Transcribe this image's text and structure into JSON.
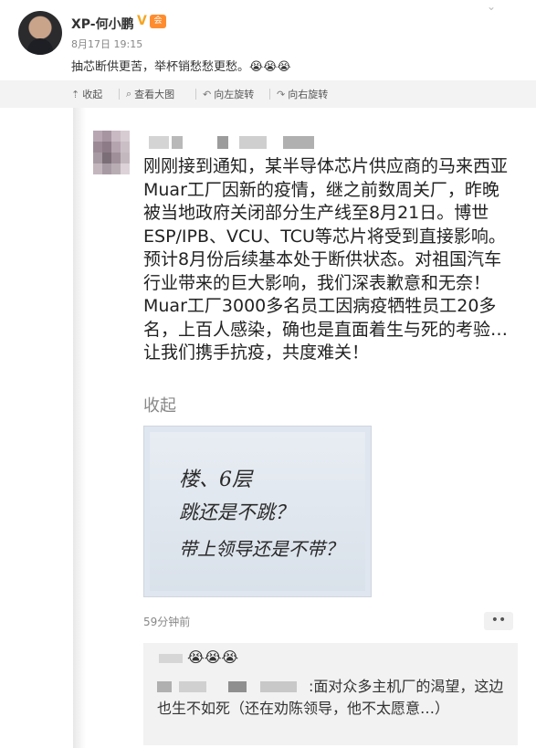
{
  "post": {
    "author": "XP-何小鹏",
    "verified_badge": "V",
    "member_badge": "会",
    "time": "8月17日 19:15",
    "text": "抽芯断供更苦，举杯销愁愁更愁。😭😭😭"
  },
  "toolbar": {
    "collapse": "收起",
    "view_large": "查看大图",
    "rotate_left": "向左旋转",
    "rotate_right": "向右旋转"
  },
  "screenshot": {
    "message": "刚刚接到通知，某半导体芯片供应商的马来西亚Muar工厂因新的疫情，继之前数周关厂，昨晚被当地政府关闭部分生产线至8月21日。博世ESP/IPB、VCU、TCU等芯片将受到直接影响。预计8月份后续基本处于断供状态。对祖国汽车行业带来的巨大影响，我们深表歉意和无奈！Muar工厂3000多名员工因病疫牺牲员工20多名，上百人感染，确也是直面着生与死的考验…让我们携手抗疫，共度难关！",
    "collapse": "收起",
    "note_lines": [
      "楼、6层",
      "跳还是不跳？",
      "带上领导还是不带？"
    ],
    "timestamp": "59分钟前",
    "more_label": "••",
    "comment_emojis": "😭😭😭",
    "comment_text": ":面对众多主机厂的渴望，这边也生不如死（还在劝陈领导，他不太愿意…）"
  },
  "icons": {
    "collapse": "collapse-icon",
    "view_large": "search-icon",
    "rotate_left": "rotate-left-icon",
    "rotate_right": "rotate-right-icon",
    "more": "chevron-down-icon"
  }
}
